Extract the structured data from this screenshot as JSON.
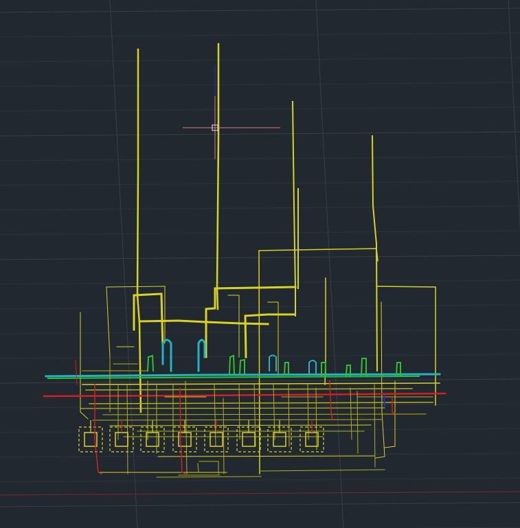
{
  "canvas": {
    "background": "#212830",
    "grid_minor": "#2b333c",
    "grid_major": "#36404a",
    "origin_axis": "#7a2a2a"
  },
  "layers": {
    "yellow": "#d8d41c",
    "yellow_dim": "#b3b018",
    "cyan": "#1fb6bf",
    "green": "#2fbf2f",
    "red": "#d02020",
    "blue": "#2a2ad8",
    "white": "#e6e6e6"
  },
  "crosshair": {
    "color": "#e07878",
    "pickbox": "#e6e6e6"
  }
}
